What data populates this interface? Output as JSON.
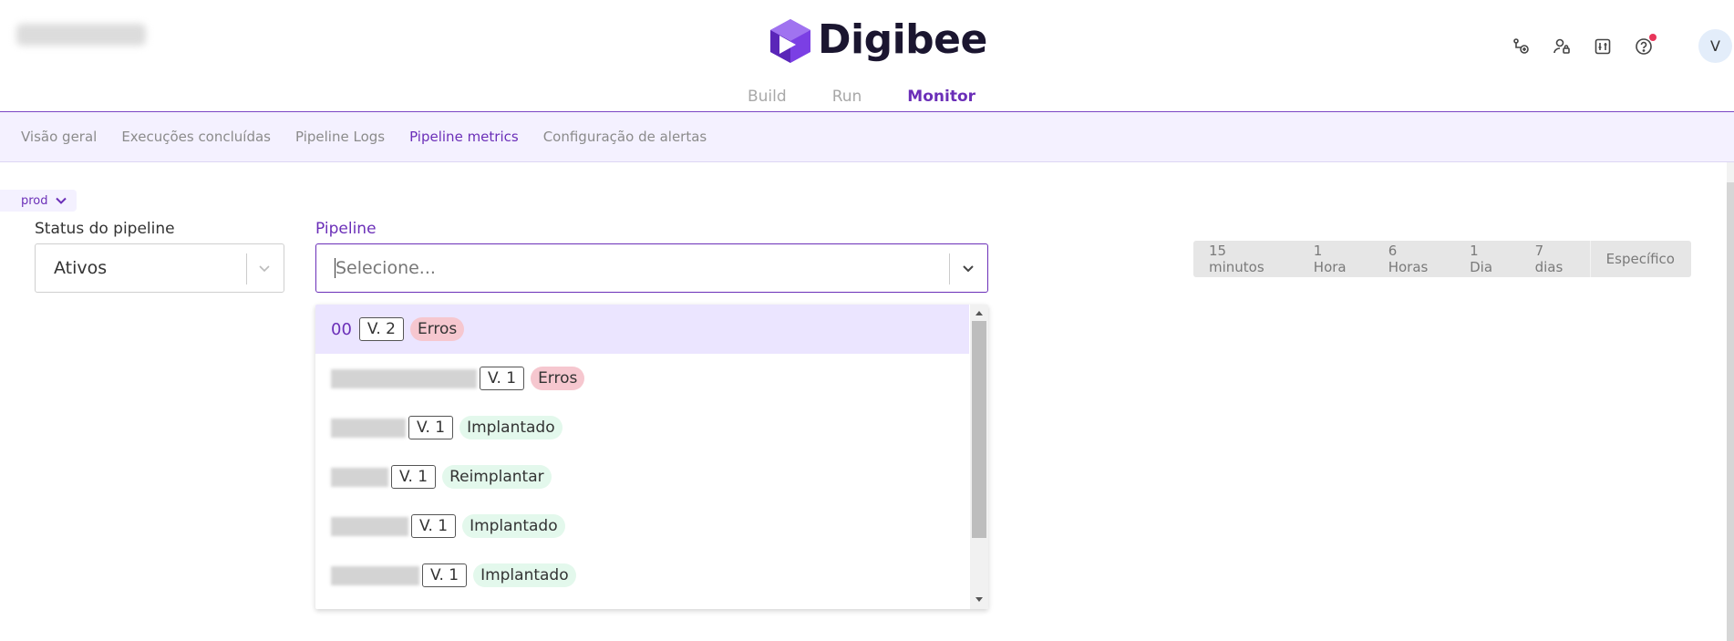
{
  "header": {
    "logo_text": "Digibee",
    "icons": [
      "pipeline-add-icon",
      "user-lock-icon",
      "settings-sliders-icon",
      "help-icon"
    ],
    "avatar_initial": "V"
  },
  "main_tabs": [
    {
      "label": "Build",
      "active": false
    },
    {
      "label": "Run",
      "active": false
    },
    {
      "label": "Monitor",
      "active": true
    }
  ],
  "subnav": [
    {
      "label": "Visão geral",
      "active": false
    },
    {
      "label": "Execuções concluídas",
      "active": false
    },
    {
      "label": "Pipeline Logs",
      "active": false
    },
    {
      "label": "Pipeline metrics",
      "active": true
    },
    {
      "label": "Configuração de alertas",
      "active": false
    }
  ],
  "environment": "prod",
  "filters": {
    "status_label": "Status do pipeline",
    "status_value": "Ativos",
    "pipeline_label": "Pipeline",
    "pipeline_placeholder": "Selecione..."
  },
  "time_ranges": [
    "15 minutos",
    "1 Hora",
    "6 Horas",
    "1 Dia",
    "7 dias",
    "Específico"
  ],
  "dropdown": {
    "options": [
      {
        "name": "00",
        "version": "V. 2",
        "status": "Erros",
        "status_type": "error",
        "highlighted": true
      },
      {
        "name": "",
        "version": "V. 1",
        "status": "Erros",
        "status_type": "error",
        "highlighted": false
      },
      {
        "name": "",
        "version": "V. 1",
        "status": "Implantado",
        "status_type": "deployed",
        "highlighted": false
      },
      {
        "name": "",
        "version": "V. 1",
        "status": "Reimplantar",
        "status_type": "redeploy",
        "highlighted": false
      },
      {
        "name": "",
        "version": "V. 1",
        "status": "Implantado",
        "status_type": "deployed",
        "highlighted": false
      },
      {
        "name": "",
        "version": "V. 1",
        "status": "Implantado",
        "status_type": "deployed",
        "highlighted": false
      }
    ]
  },
  "colors": {
    "accent": "#6b2fb8",
    "subnav_bg": "#f4f1ff",
    "error_badge": "#f6c7cf",
    "deployed_badge": "#e3f8ec",
    "notification_dot": "#e8355a"
  }
}
